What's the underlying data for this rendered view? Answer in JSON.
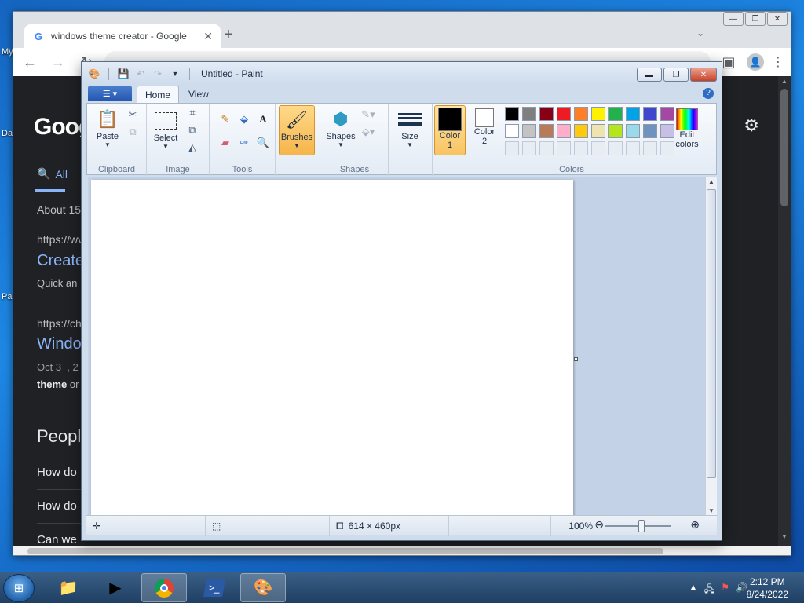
{
  "desktop": {
    "labels": [
      "My",
      "Da",
      "Pa"
    ]
  },
  "chrome": {
    "tab_title": "windows theme creator - Google",
    "window_controls": [
      "—",
      "❐",
      "✕"
    ],
    "page": {
      "logo": "Goog",
      "tab_all": "All",
      "about": "About 15",
      "results": [
        {
          "url": "https://wv",
          "title": "Create",
          "snippet": "Quick an"
        },
        {
          "url": "https://ch",
          "title": "Windo",
          "date": "Oct 3  , 2",
          "bold": "theme",
          "rest": " or"
        }
      ],
      "people_also_ask": "Peopl",
      "questions": [
        "How do",
        "How do",
        "Can we"
      ]
    }
  },
  "paint": {
    "title": "Untitled - Paint",
    "tabs": {
      "home": "Home",
      "view": "View"
    },
    "groups": {
      "clipboard": "Clipboard",
      "image": "Image",
      "tools": "Tools",
      "shapes": "Shapes",
      "colors": "Colors"
    },
    "buttons": {
      "paste": "Paste",
      "select": "Select",
      "brushes": "Brushes",
      "shapes": "Shapes",
      "size": "Size",
      "color1_line1": "Color",
      "color1_line2": "1",
      "color2_line1": "Color",
      "color2_line2": "2",
      "edit_colors_line1": "Edit",
      "edit_colors_line2": "colors"
    },
    "color1": "#000000",
    "color2": "#ffffff",
    "palette_row1": [
      "#000000",
      "#7f7f7f",
      "#880015",
      "#ed1c24",
      "#ff7f27",
      "#fff200",
      "#22b14c",
      "#00a2e8",
      "#3f48cc",
      "#a349a4"
    ],
    "palette_row2": [
      "#ffffff",
      "#c3c3c3",
      "#b97a57",
      "#ffaec9",
      "#ffc90e",
      "#efe4b0",
      "#b5e61d",
      "#99d9ea",
      "#7092be",
      "#c8bfe7"
    ],
    "status": {
      "dimensions": "614 × 460px",
      "zoom": "100%"
    }
  },
  "taskbar": {
    "time": "2:12 PM",
    "date": "8/24/2022"
  }
}
